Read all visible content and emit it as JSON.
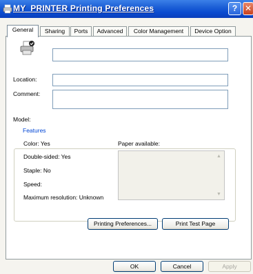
{
  "window": {
    "title": "MY_PRINTER Printing Preferences"
  },
  "tabs": [
    {
      "label": "General"
    },
    {
      "label": "Sharing"
    },
    {
      "label": "Ports"
    },
    {
      "label": "Advanced"
    },
    {
      "label": "Color Management"
    },
    {
      "label": "Device Option"
    }
  ],
  "general": {
    "printer_name_value": "",
    "location_label": "Location:",
    "location_value": "",
    "comment_label": "Comment:",
    "comment_value": "",
    "model_label": "Model:",
    "model_value": ""
  },
  "features": {
    "legend": "Features",
    "color": "Color: Yes",
    "double_sided": "Double-sided: Yes",
    "staple": "Staple: No",
    "speed_label": "Speed:",
    "max_resolution": "Maximum resolution: Unknown",
    "paper_available_label": "Paper available:"
  },
  "buttons": {
    "printing_preferences": "Printing Preferences...",
    "print_test_page": "Print Test Page",
    "ok": "OK",
    "cancel": "Cancel",
    "apply": "Apply"
  },
  "icons": [
    "printer-icon",
    "help-icon",
    "close-icon",
    "scroll-up-icon",
    "scroll-down-icon"
  ]
}
